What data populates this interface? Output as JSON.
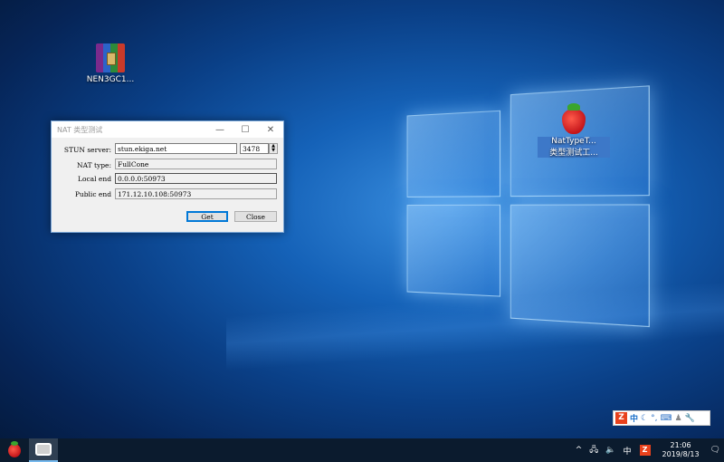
{
  "desktop": {
    "icons": [
      {
        "label": "NEN3GC1..."
      },
      {
        "label_line1": "NatTypeT...",
        "label_line2": "类型测试工..."
      }
    ]
  },
  "dialog": {
    "title": "NAT 类型测试",
    "controls": {
      "minimize": "—",
      "maximize": "☐",
      "close": "✕"
    },
    "stun_label": "STUN server:",
    "stun_value": "stun.ekiga.net",
    "port_value": "3478",
    "nat_type_label": "NAT type:",
    "nat_type_value": "FullCone",
    "local_end_label": "Local end",
    "local_end_value": "0.0.0.0:50973",
    "public_end_label": "Public end",
    "public_end_value": "171.12.10.108:50973",
    "get_label": "Get",
    "close_label": "Close"
  },
  "ime": {
    "logo": "Z",
    "mode": "中",
    "icons": [
      "moon-icon",
      "punctuation-icon",
      "keyboard-icon",
      "user-icon",
      "wrench-icon"
    ]
  },
  "taskbar": {
    "tray_chevron": "^",
    "tray_ime": "中",
    "tray_z": "Z",
    "time": "21:06",
    "date": "2019/8/13"
  },
  "colors": {
    "accent": "#0078d7",
    "ime_red": "#e8411c",
    "taskbar": "#0b1b2e"
  }
}
